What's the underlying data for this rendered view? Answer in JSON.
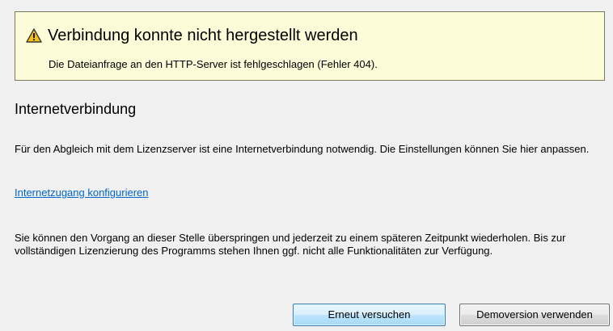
{
  "alert": {
    "icon": "warning-icon",
    "title": "Verbindung konnte nicht hergestellt werden",
    "message": "Die Dateianfrage an den HTTP-Server ist fehlgeschlagen (Fehler 404)."
  },
  "section": {
    "heading": "Internetverbindung",
    "description": "Für den Abgleich mit dem Lizenzserver ist eine Internetverbindung notwendig. Die Einstellungen können Sie hier anpassen.",
    "link_label": "Internetzugang konfigurieren",
    "skip_note": "Sie können den Vorgang an dieser Stelle überspringen und jederzeit zu einem späteren Zeitpunkt wiederholen. Bis zur vollständigen Lizenzierung des Programms stehen Ihnen ggf. nicht alle Funktionalitäten zur Verfügung."
  },
  "buttons": {
    "retry_label": "Erneut versuchen",
    "demo_label": "Demoversion verwenden"
  },
  "colors": {
    "alert_background": "#fcfcd9",
    "link": "#0066cc",
    "warning_yellow": "#f5c211"
  }
}
